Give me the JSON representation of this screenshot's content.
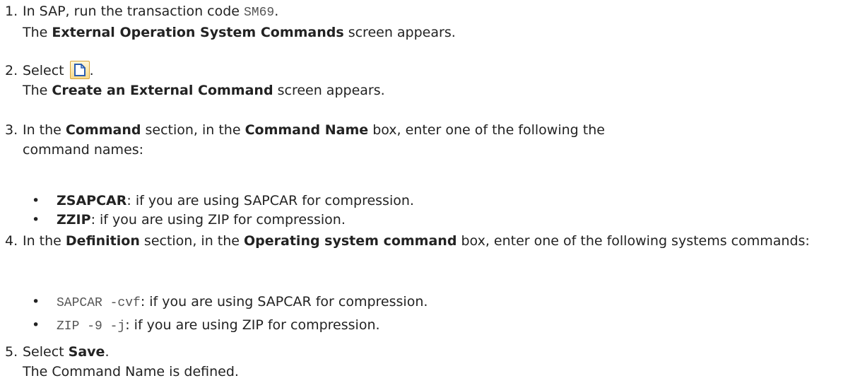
{
  "steps": [
    {
      "number": "1.",
      "line1": {
        "pre": "In SAP, run the transaction code ",
        "code": "SM69",
        "post": "."
      },
      "line2": {
        "pre": "The ",
        "bold": "External Operation System Commands",
        "post": " screen appears."
      }
    },
    {
      "number": "2.",
      "line1": {
        "pre": "Select ",
        "icon": "new-document-icon",
        "post": "."
      },
      "line2": {
        "pre": "The ",
        "bold": "Create an External Command",
        "post": " screen appears."
      }
    },
    {
      "number": "3.",
      "line1": {
        "pre": "In the ",
        "bold1": "Command",
        "mid": " section, in the ",
        "bold2": "Command Name",
        "post": " box, enter one of the following the command names:"
      },
      "bullets": [
        {
          "bold": "ZSAPCAR",
          "post": ": if you are using SAPCAR for compression."
        },
        {
          "bold": "ZZIP",
          "post": ": if you are using ZIP for compression."
        }
      ]
    },
    {
      "number": "4.",
      "line1": {
        "pre": "In the ",
        "bold1": "Definition",
        "mid": " section, in the ",
        "bold2": "Operating system command",
        "post": " box, enter one of the following systems commands:"
      },
      "bullets": [
        {
          "code": "SAPCAR -cvf",
          "post": ": if you are using SAPCAR for compression."
        },
        {
          "code": "ZIP -9 -j",
          "post": ": if you are using ZIP for compression."
        }
      ]
    },
    {
      "number": "5.",
      "line1": {
        "pre": "Select ",
        "bold": "Save",
        "post": "."
      },
      "line2": {
        "text": "The Command Name is defined."
      }
    }
  ],
  "bullet_glyph": "•"
}
